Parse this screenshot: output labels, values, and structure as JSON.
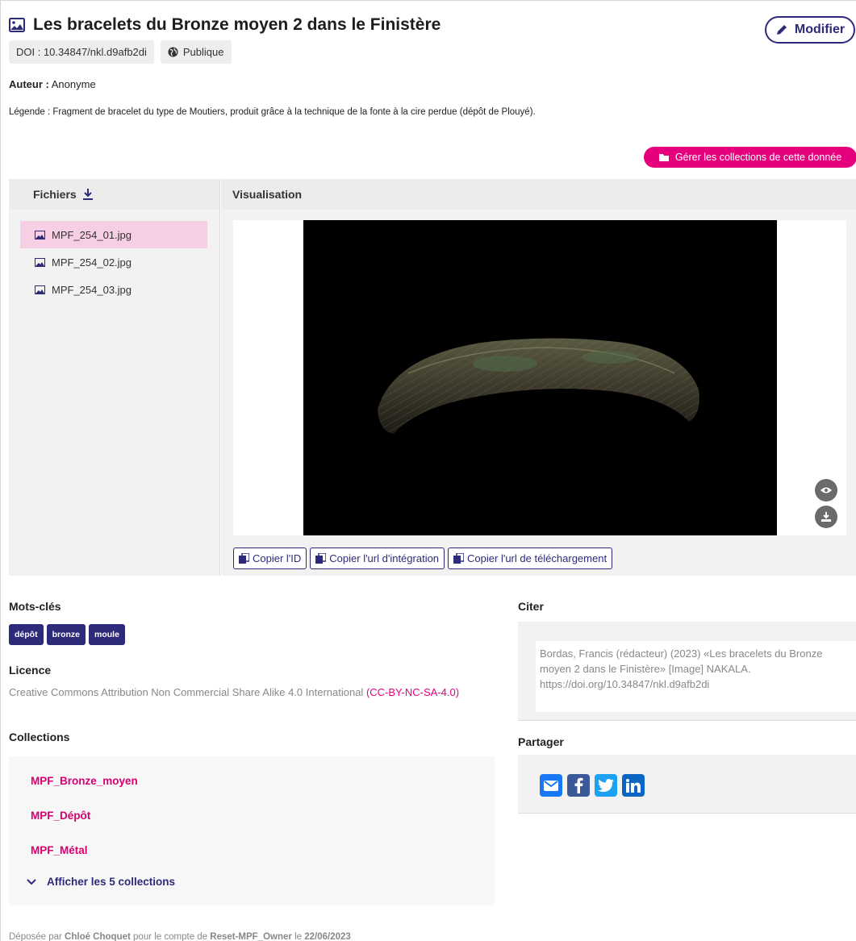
{
  "header": {
    "title": "Les bracelets du Bronze moyen 2 dans le Finistère",
    "doi": "DOI : 10.34847/nkl.d9afb2di",
    "visibility": "Publique",
    "modify_label": "Modifier"
  },
  "meta": {
    "author_label": "Auteur :",
    "author_value": "Anonyme",
    "legend": "Légende : Fragment de bracelet du type de Moutiers, produit grâce à la technique de la fonte à la cire perdue (dépôt de Plouyé)."
  },
  "manage_collections_label": "Gérer les collections de cette donnée",
  "files": {
    "header": "Fichiers",
    "items": [
      {
        "name": "MPF_254_01.jpg",
        "active": true
      },
      {
        "name": "MPF_254_02.jpg",
        "active": false
      },
      {
        "name": "MPF_254_03.jpg",
        "active": false
      }
    ]
  },
  "visualisation": {
    "header": "Visualisation",
    "copy_id": "Copier l'ID",
    "copy_embed": "Copier l'url d'intégration",
    "copy_download": "Copier l'url de téléchargement"
  },
  "keywords": {
    "title": "Mots-clés",
    "tags": [
      "dépôt",
      "bronze",
      "moule"
    ]
  },
  "licence": {
    "title": "Licence",
    "text": "Creative Commons Attribution Non Commercial Share Alike 4.0 International ",
    "link": "(CC-BY-NC-SA-4.0)"
  },
  "collections": {
    "title": "Collections",
    "items": [
      "MPF_Bronze_moyen",
      "MPF_Dépôt",
      "MPF_Métal"
    ],
    "show_all": "Afficher les 5 collections"
  },
  "cite": {
    "title": "Citer",
    "text": "Bordas, Francis (rédacteur) (2023) «Les bracelets du Bronze moyen 2 dans le Finistère» [Image] NAKALA. https://doi.org/10.34847/nkl.d9afb2di"
  },
  "share": {
    "title": "Partager",
    "icons": [
      "email-icon",
      "facebook-icon",
      "twitter-icon",
      "linkedin-icon"
    ]
  },
  "footer": {
    "prefix": "Déposée par ",
    "depositor": "Chloé Choquet",
    "middle": " pour le compte de ",
    "account": "Reset-MPF_Owner",
    "date_prefix": " le ",
    "date": "22/06/2023"
  },
  "colors": {
    "accent_pink": "#e6007e",
    "accent_navy": "#2e2a7a",
    "active_file_bg": "#f7cfe4"
  }
}
